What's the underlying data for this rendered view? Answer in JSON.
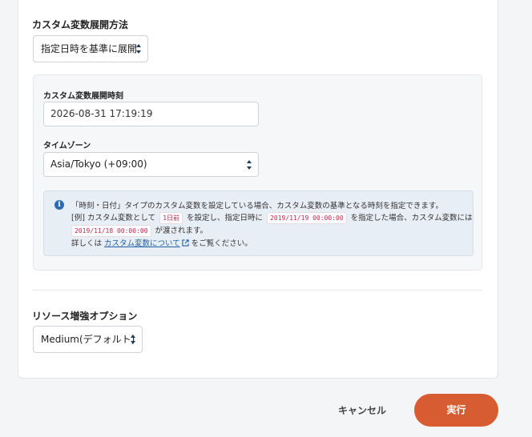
{
  "expansion_method": {
    "label": "カスタム変数展開方法",
    "selected": "指定日時を基準に展開"
  },
  "expansion_datetime": {
    "label": "カスタム変数展開時刻",
    "value": "2026-08-31 17:19:19"
  },
  "timezone": {
    "label": "タイムゾーン",
    "selected": "Asia/Tokyo (+09:00)"
  },
  "info_box": {
    "line1": "「時刻・日付」タイプのカスタム変数を設定している場合、カスタム変数の基準となる時刻を指定できます。",
    "line2_a": "[例] カスタム変数として",
    "line2_code1": "1日前",
    "line2_b": "を設定し、指定日時に",
    "line2_code2": "2019/11/19 00:00:00",
    "line2_c": "を指定した場合、カスタム変数には",
    "line3_code": "2019/11/18 00:00:00",
    "line3_text": "が渡されます。",
    "line4_a": "詳しくは",
    "line4_link": "カスタム変数について",
    "line4_b": "をご覧ください。"
  },
  "resource_option": {
    "label": "リソース増強オプション",
    "selected": "Medium(デフォルト)"
  },
  "footer": {
    "cancel_label": "キャンセル",
    "run_label": "実行"
  },
  "colors": {
    "primary": "#d85c32",
    "info_icon": "#2b6cb0",
    "link": "#1f5fa8"
  }
}
